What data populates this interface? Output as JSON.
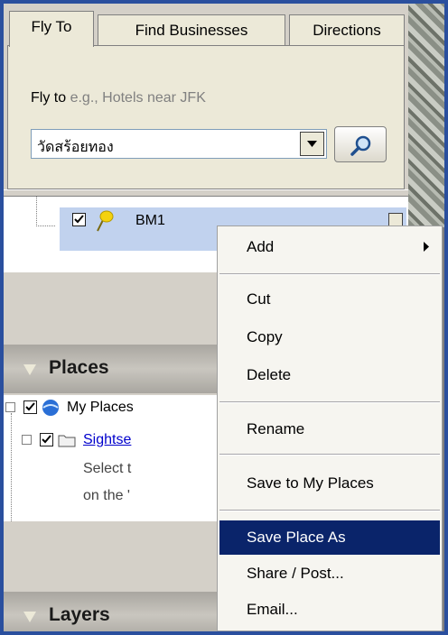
{
  "tabs": [
    "Fly To",
    "Find Businesses",
    "Directions"
  ],
  "flyto": {
    "label": "Fly to",
    "placeholder": "e.g., Hotels near JFK",
    "value": "วัดสร้อยทอง"
  },
  "tree1": {
    "item": "BM1"
  },
  "panels": {
    "places": "Places",
    "layers": "Layers"
  },
  "places_tree": {
    "my_places": "My Places",
    "sightseeing": "Sightse",
    "desc1": "Select t",
    "desc2": "on the '"
  },
  "menu": {
    "add": "Add",
    "cut": "Cut",
    "copy": "Copy",
    "delete": "Delete",
    "rename": "Rename",
    "save_to_my_places": "Save to My Places",
    "save_place_as": "Save Place As",
    "share_post": "Share / Post...",
    "email": "Email..."
  },
  "colors": {
    "selection": "#0a246a",
    "frame": "#2a4f9e",
    "link": "#0000cc"
  },
  "icons": [
    "search-icon",
    "pushpin-icon",
    "globe-icon",
    "folder-icon",
    "checkbox-icon",
    "dropdown-arrow-icon",
    "submenu-arrow-icon",
    "collapse-triangle-icon"
  ]
}
